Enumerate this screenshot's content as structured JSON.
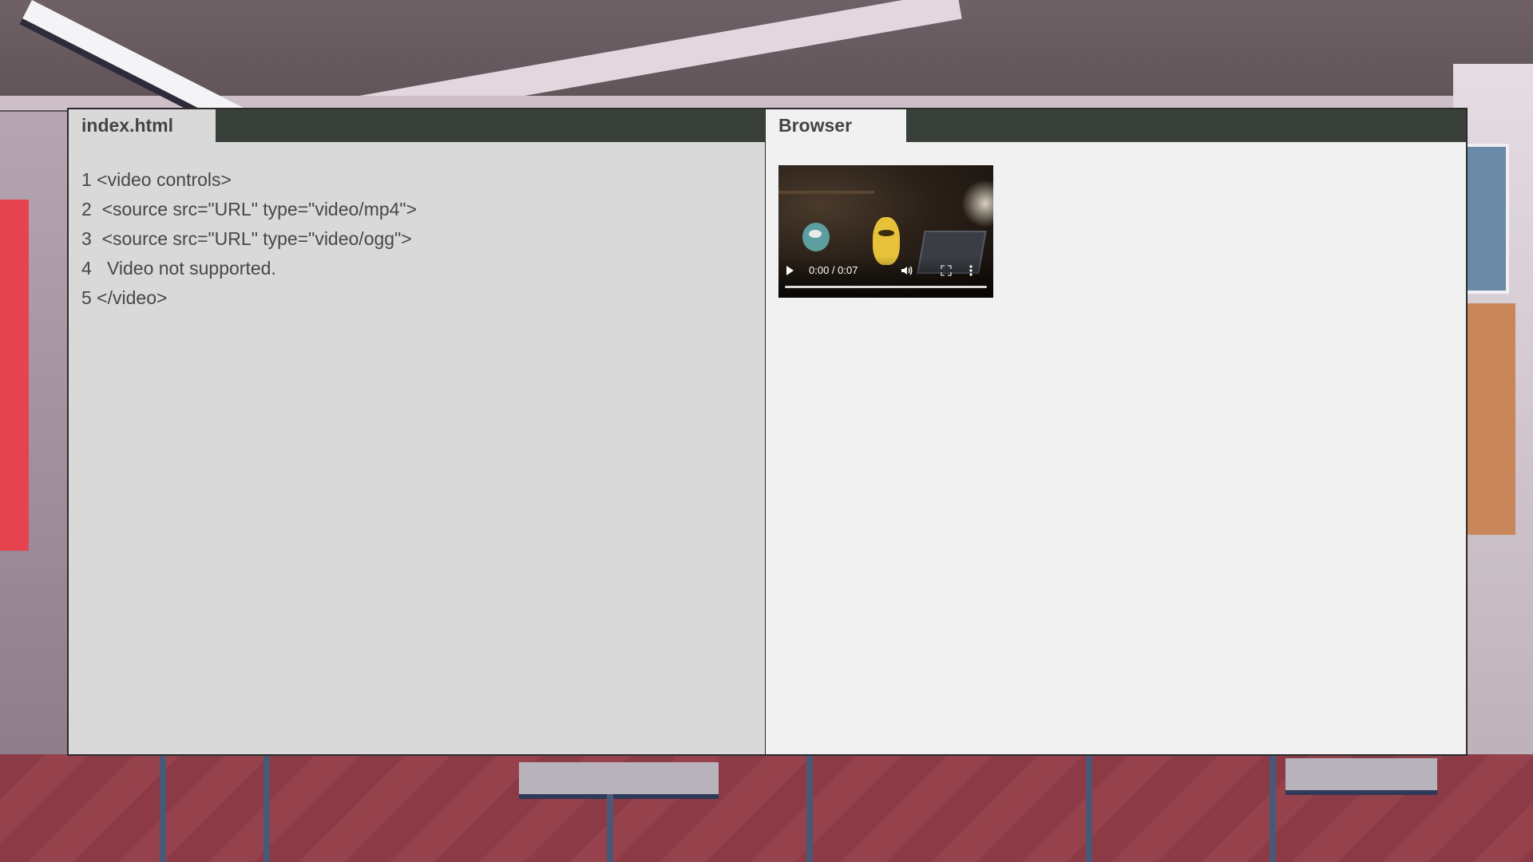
{
  "editor": {
    "tab_label": "index.html",
    "lines": [
      "1 <video controls>",
      "2  <source src=\"URL\" type=\"video/mp4\">",
      "3  <source src=\"URL\" type=\"video/ogg\">",
      "4   Video not supported.",
      "5 </video>"
    ]
  },
  "browser": {
    "tab_label": "Browser",
    "video": {
      "time_display": "0:00 / 0:07",
      "progress_fraction": 0,
      "icons": [
        "play-icon",
        "volume-icon",
        "fullscreen-icon",
        "more-options-icon"
      ]
    }
  },
  "colors": {
    "tabbar": "#394039",
    "editor_bg": "#d9d9d9",
    "browser_bg": "#f1f1f1",
    "text": "#474747"
  }
}
